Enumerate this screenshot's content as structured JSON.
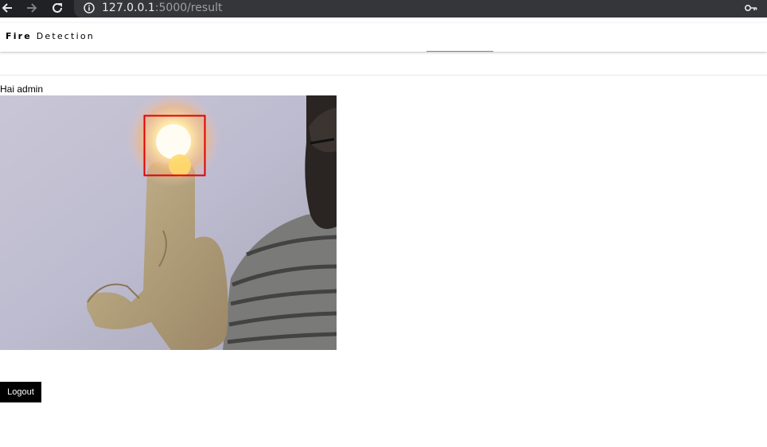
{
  "browser": {
    "url_host": "127.0.0.1",
    "url_path": ":5000/result",
    "icons": [
      "back-arrow-icon",
      "forward-arrow-icon",
      "reload-icon",
      "info-icon",
      "key-icon"
    ]
  },
  "navbar": {
    "brand_strong": "Fire",
    "brand_rest": "Detection"
  },
  "greeting": "Hai admin",
  "detection_box_color": "#e00000",
  "logout_label": "Logout"
}
